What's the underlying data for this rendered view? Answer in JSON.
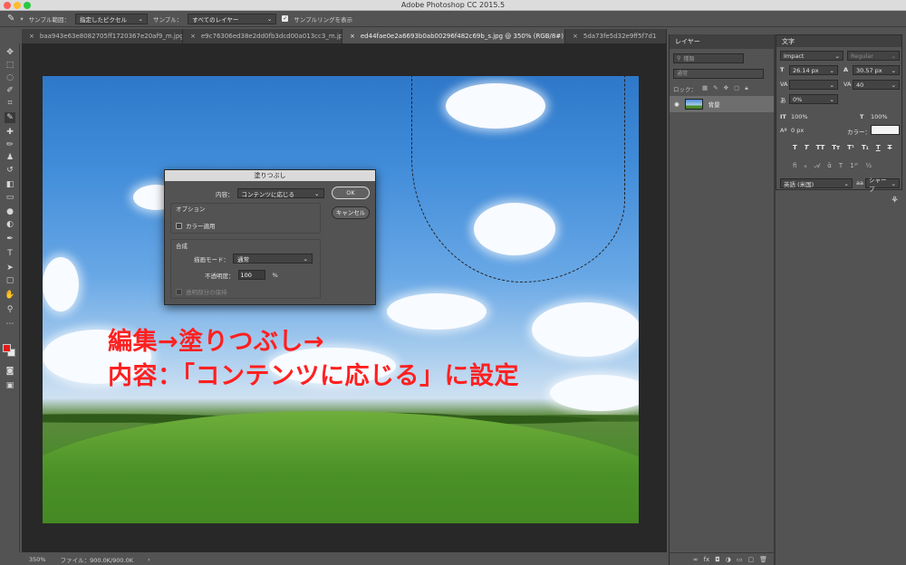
{
  "app": {
    "title": "Adobe Photoshop CC 2015.5"
  },
  "options_bar": {
    "sample_size_label": "サンプル範囲：",
    "sample_size_value": "指定したピクセル",
    "sample_label": "サンプル：",
    "sample_value": "すべてのレイヤー",
    "show_ring_label": "サンプルリングを表示"
  },
  "tabs": [
    {
      "label": "baa943e63e8082705ff1720367e20af9_m.jpg"
    },
    {
      "label": "e9c76306ed38e2dd0fb3dcd00a013cc3_m.jpg"
    },
    {
      "label": "ed44fae0e2a6693b0ab00296f482c69b_s.jpg @ 350% (RGB/8#) *"
    },
    {
      "label": "5da73fe5d32e9ff5f7d1"
    }
  ],
  "dialog": {
    "title": "塗りつぶし",
    "contents_label": "内容：",
    "contents_value": "コンテンツに応じる",
    "ok_label": "OK",
    "cancel_label": "キャンセル",
    "options_group": "オプション",
    "color_adapt_label": "カラー適用",
    "blend_group": "合成",
    "mode_label": "描画モード：",
    "mode_value": "通常",
    "opacity_label": "不透明度：",
    "opacity_value": "100",
    "opacity_unit": "%",
    "preserve_label": "透明部分の保持"
  },
  "annotation": {
    "line1": "編集→塗りつぶし→",
    "line2": "内容：「コンテンツに応じる」に設定"
  },
  "status_bar": {
    "zoom": "350%",
    "file_info": "ファイル：900.0K/900.0K"
  },
  "layers_panel": {
    "tab_label": "レイヤー",
    "search_placeholder": "種類",
    "blend_mode": "通常",
    "lock_label": "ロック：",
    "layer_name": "背景"
  },
  "character_panel": {
    "tab_label": "文字",
    "font_family": "Impact",
    "font_style": "Regular",
    "font_size": "26.14 px",
    "leading": "30.57 px",
    "kerning": "",
    "tracking": "40",
    "tsume": "0%",
    "vertical_scale": "100%",
    "horizontal_scale": "100%",
    "baseline_shift": "0 px",
    "color_label": "カラー：",
    "language": "英語 (米国)",
    "antialias": "シャープ"
  },
  "colors": {
    "foreground": "#e21b1b",
    "background": "#e8e8e8",
    "annotation": "#ff2020"
  }
}
